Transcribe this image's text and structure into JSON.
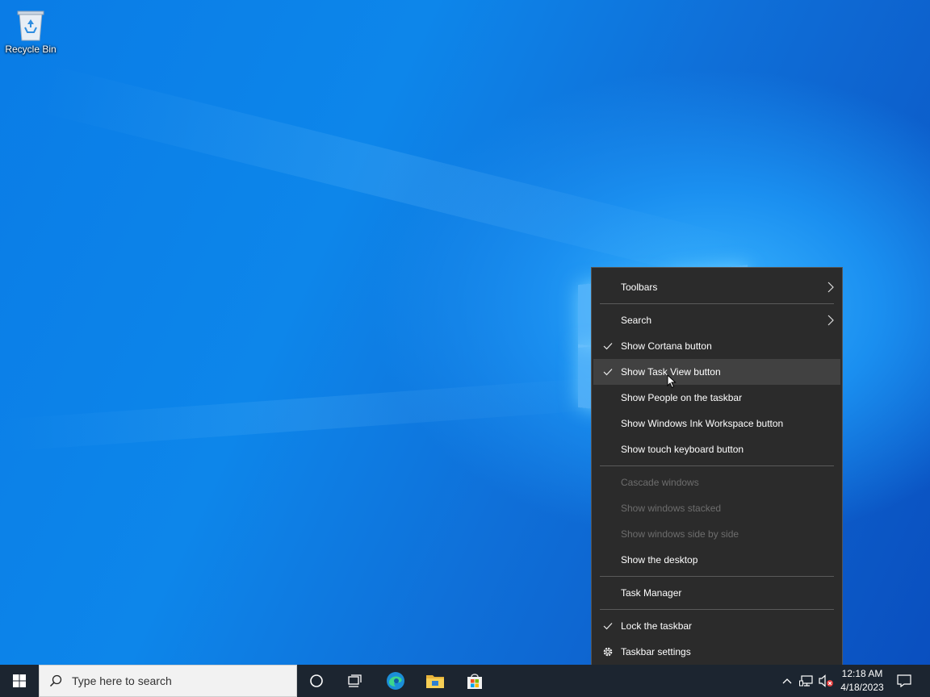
{
  "desktop": {
    "icons": [
      {
        "label": "Recycle Bin",
        "icon": "recycle-bin-icon"
      }
    ]
  },
  "context_menu": {
    "items": [
      {
        "label": "Toolbars",
        "checked": false,
        "submenu": true,
        "disabled": false
      },
      {
        "label": "Search",
        "checked": false,
        "submenu": true,
        "disabled": false
      },
      {
        "label": "Show Cortana button",
        "checked": true,
        "submenu": false,
        "disabled": false
      },
      {
        "label": "Show Task View button",
        "checked": true,
        "submenu": false,
        "disabled": false,
        "hovered": true
      },
      {
        "label": "Show People on the taskbar",
        "checked": false,
        "submenu": false,
        "disabled": false
      },
      {
        "label": "Show Windows Ink Workspace button",
        "checked": false,
        "submenu": false,
        "disabled": false
      },
      {
        "label": "Show touch keyboard button",
        "checked": false,
        "submenu": false,
        "disabled": false
      },
      {
        "label": "Cascade windows",
        "checked": false,
        "submenu": false,
        "disabled": true
      },
      {
        "label": "Show windows stacked",
        "checked": false,
        "submenu": false,
        "disabled": true
      },
      {
        "label": "Show windows side by side",
        "checked": false,
        "submenu": false,
        "disabled": true
      },
      {
        "label": "Show the desktop",
        "checked": false,
        "submenu": false,
        "disabled": false
      },
      {
        "label": "Task Manager",
        "checked": false,
        "submenu": false,
        "disabled": false
      },
      {
        "label": "Lock the taskbar",
        "checked": true,
        "submenu": false,
        "disabled": false
      },
      {
        "label": "Taskbar settings",
        "icon": "gear-icon",
        "submenu": false,
        "disabled": false
      }
    ]
  },
  "taskbar": {
    "search_placeholder": "Type here to search",
    "pinned": [
      "cortana-icon",
      "task-view-icon",
      "edge-icon",
      "file-explorer-icon",
      "microsoft-store-icon"
    ],
    "tray_icons": [
      "chevron-up-icon",
      "network-icon",
      "volume-muted-icon"
    ],
    "clock_time": "12:18 AM",
    "clock_date": "4/18/2023"
  },
  "colors": {
    "menu_bg": "#2b2b2b",
    "menu_hover": "#414141",
    "menu_disabled_text": "#6d6d6d",
    "taskbar_bg": "#1c2530",
    "desktop_blue": "#0a7ce6"
  }
}
